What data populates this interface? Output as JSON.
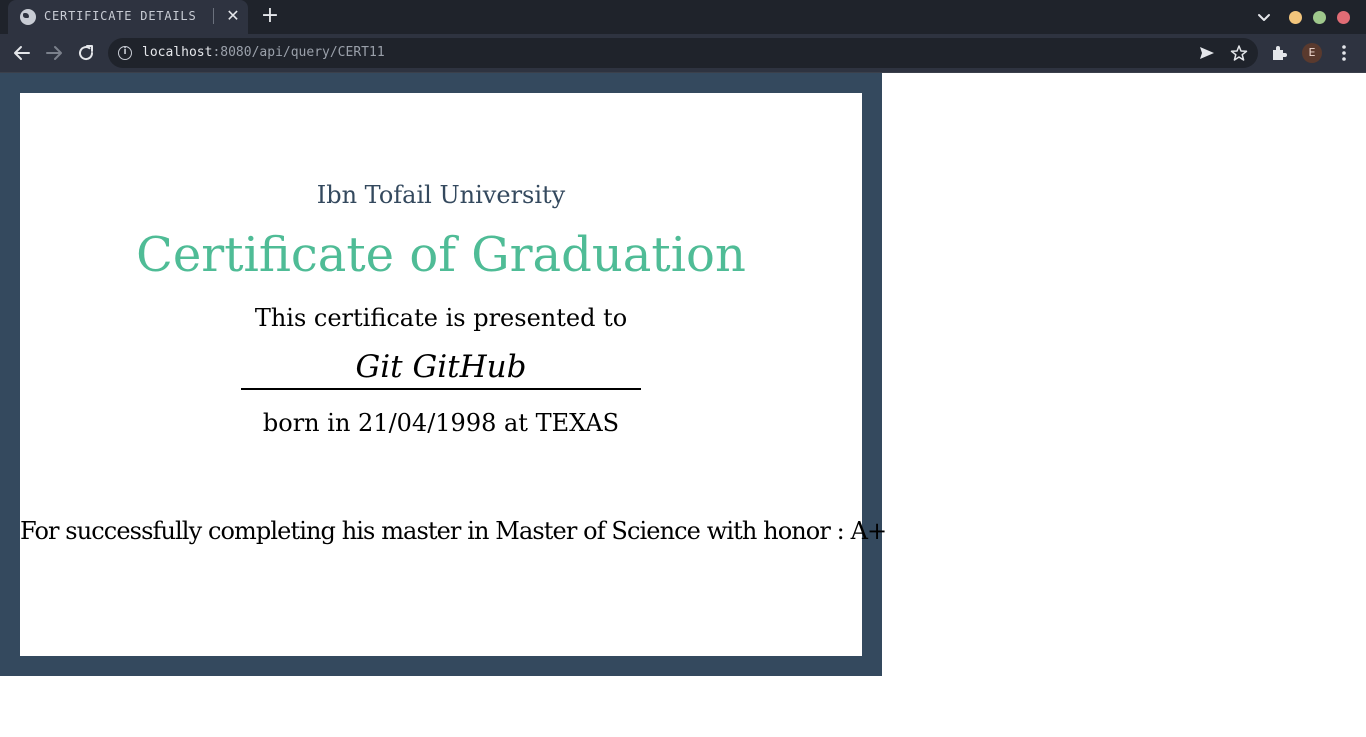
{
  "browser": {
    "tab_title": "CERTIFICATE DETAILS",
    "url_host": "localhost",
    "url_path": ":8080/api/query/CERT11",
    "profile_initial": "E",
    "window_dots": [
      "#f2c57c",
      "#9fc88c",
      "#e06c75"
    ]
  },
  "certificate": {
    "university": "Ibn Tofail University",
    "title": "Certificate of Graduation",
    "presented_text": "This certificate is presented to",
    "recipient": "Git GitHub",
    "born_text": "born in 21/04/1998 at TEXAS",
    "completion_text": "For successfully completing his master in Master of Science with honor : A+"
  },
  "colors": {
    "frame": "#34495e",
    "title_accent": "#4fbc96",
    "university_text": "#34495e"
  }
}
